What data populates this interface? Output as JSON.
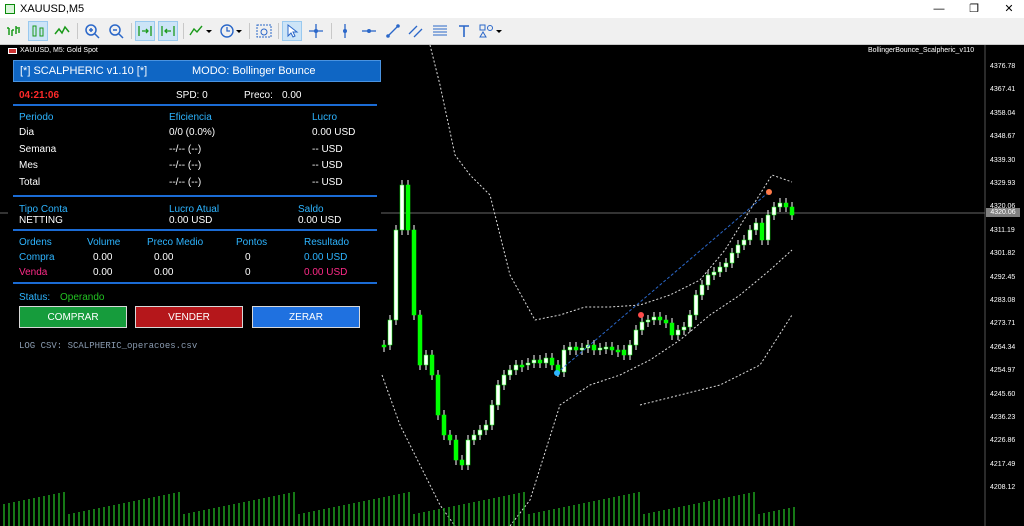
{
  "window": {
    "title": "XAUUSD,M5",
    "minimize": "—",
    "restore": "❐",
    "close": "✕"
  },
  "toolbar": {
    "icons": [
      "new-order-icon",
      "bar-chart-icon",
      "candles-icon",
      "line-chart-icon",
      "zoom-in-icon",
      "zoom-out-icon",
      "autoscroll-icon",
      "chart-shift-icon",
      "indicators-icon",
      "periods-icon",
      "templates-icon",
      "screenshot-icon",
      "cursor-icon",
      "crosshair-icon",
      "vertical-line-icon",
      "horizontal-line-icon",
      "trendline-icon",
      "channel-icon",
      "fibonacci-icon",
      "text-icon",
      "shapes-icon"
    ]
  },
  "chart": {
    "symbol_label": "XAUUSD, M5:  Gold Spot",
    "ea_name": "BollingerBounce_Scalpheric_v110",
    "price_levels": [
      "4376.78",
      "4367.41",
      "4358.04",
      "4348.67",
      "4339.30",
      "4329.93",
      "4320.06",
      "4311.19",
      "4301.82",
      "4292.45",
      "4283.08",
      "4273.71",
      "4264.34",
      "4254.97",
      "4245.60",
      "4236.23",
      "4226.86",
      "4217.49",
      "4208.12"
    ],
    "current_price": "4320.06"
  },
  "panel": {
    "title": "[*] SCALPHERIC v1.10 [*]",
    "mode": "MODO: Bollinger Bounce",
    "time": "04:21:06",
    "spread_label": "SPD: 0",
    "price_label": "Preco:",
    "price_value": "0.00",
    "stats_headers": {
      "period": "Periodo",
      "efficiency": "Eficiencia",
      "profit": "Lucro"
    },
    "stats": [
      {
        "period": "Dia",
        "efficiency": "0/0 (0.0%)",
        "profit": "0.00 USD"
      },
      {
        "period": "Semana",
        "efficiency": "--/-- (--)",
        "profit": "-- USD"
      },
      {
        "period": "Mes",
        "efficiency": "--/-- (--)",
        "profit": "-- USD"
      },
      {
        "period": "Total",
        "efficiency": "--/-- (--)",
        "profit": "-- USD"
      }
    ],
    "account_headers": {
      "type": "Tipo Conta",
      "current_profit": "Lucro Atual",
      "balance": "Saldo"
    },
    "account": {
      "type": "NETTING",
      "current_profit": "0.00 USD",
      "balance": "0.00 USD"
    },
    "orders_headers": {
      "orders": "Ordens",
      "volume": "Volume",
      "avg_price": "Preco Medio",
      "points": "Pontos",
      "result": "Resultado"
    },
    "orders": [
      {
        "side": "Compra",
        "volume": "0.00",
        "avg_price": "0.00",
        "points": "0",
        "result": "0.00 USD"
      },
      {
        "side": "Venda",
        "volume": "0.00",
        "avg_price": "0.00",
        "points": "0",
        "result": "0.00 USD"
      }
    ],
    "status_label": "Status:",
    "status_value": "Operando",
    "buttons": {
      "buy": "COMPRAR",
      "sell": "VENDER",
      "zero": "ZERAR"
    },
    "log": "LOG CSV: SCALPHERIC_operacoes.csv"
  }
}
